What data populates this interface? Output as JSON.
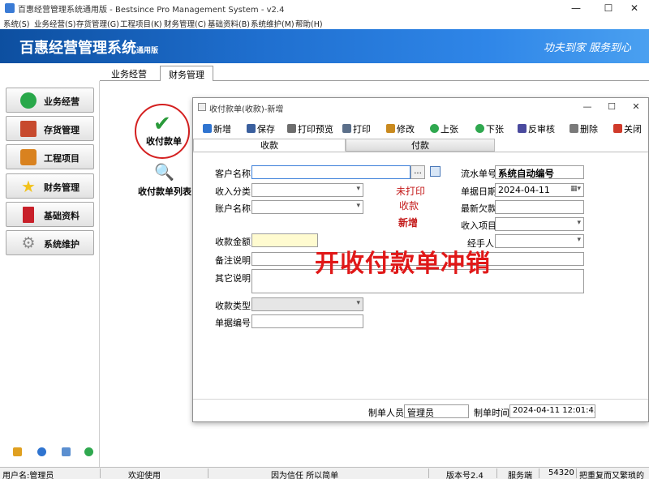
{
  "window": {
    "title": "百惠经营管理系统通用版 - Bestsince Pro Management System - v2.4",
    "controls": {
      "minimize": "—",
      "maximize": "☐",
      "close": "✕"
    }
  },
  "menu": [
    "系统(S)",
    "业务经营(S)",
    "存货管理(G)",
    "工程项目(K)",
    "财务管理(C)",
    "基础资料(B)",
    "系统维护(M)",
    "帮助(H)"
  ],
  "banner": {
    "brand": "百惠经营管理系统",
    "edition": "通用版",
    "slogan": "功夫到家 服务到心"
  },
  "sidebar": {
    "items": [
      {
        "label": "业务经营",
        "icon": "check-circle-icon",
        "color": "#29a84a"
      },
      {
        "label": "存货管理",
        "icon": "house-icon",
        "color": "#c74a2e"
      },
      {
        "label": "工程项目",
        "icon": "puzzle-icon",
        "color": "#d9821f"
      },
      {
        "label": "财务管理",
        "icon": "star-icon",
        "color": "#f2c21b"
      },
      {
        "label": "基础资料",
        "icon": "book-icon",
        "color": "#c8202a"
      },
      {
        "label": "系统维护",
        "icon": "gear-icon",
        "color": "#8a8a8a"
      }
    ]
  },
  "tabs": [
    {
      "label": "业务经营"
    },
    {
      "label": "财务管理"
    }
  ],
  "launchers": [
    {
      "label": "收付款单",
      "icon": "check-mark-icon"
    },
    {
      "label": "收付款单列表",
      "icon": "magnifier-icon"
    }
  ],
  "dialog": {
    "title": "收付款单(收款)-新增",
    "controls": {
      "minimize": "—",
      "maximize": "☐",
      "close": "✕"
    },
    "toolbar": [
      {
        "label": "新增",
        "icon": "plus-icon",
        "color": "#2f74d0"
      },
      {
        "label": "保存",
        "icon": "save-icon",
        "color": "#3a5f9e"
      },
      {
        "label": "打印预览",
        "icon": "print-preview-icon",
        "color": "#6d6d6d"
      },
      {
        "label": "打印",
        "icon": "printer-icon",
        "color": "#5b6f8a"
      },
      {
        "label": "修改",
        "icon": "edit-icon",
        "color": "#c98a1f"
      },
      {
        "label": "上张",
        "icon": "previous-icon",
        "color": "#2fa84f"
      },
      {
        "label": "下张",
        "icon": "next-icon",
        "color": "#2fa84f"
      },
      {
        "label": "反审核",
        "icon": "unapprove-icon",
        "color": "#4a4a9e"
      },
      {
        "label": "删除",
        "icon": "delete-icon",
        "color": "#7a7a7a"
      },
      {
        "label": "关闭",
        "icon": "close-door-icon",
        "color": "#d03a2a"
      }
    ],
    "subtabs": [
      "收款",
      "付款"
    ],
    "form": {
      "customer_label": "客户名称",
      "customer_value": "",
      "ellipsis": "...",
      "income_type_label": "收入分类",
      "account_label": "账户名称",
      "amount_label": "收款金额",
      "remarks_label": "备注说明",
      "other_label": "其它说明",
      "collect_type_label": "收款类型",
      "doc_no_label": "单据编号",
      "serial_label": "流水单号",
      "serial_value": "系统自动编号",
      "date_label": "单据日期",
      "date_value": "2024-04-11",
      "debt_label": "最新欠款",
      "income_item_label": "收入项目",
      "handler_label": "经手人",
      "status_print": "未打印",
      "status_kind": "收款",
      "status_mode": "新增",
      "watermark": "开收付款单冲销"
    },
    "footer": {
      "creator_label": "制单人员",
      "creator_value": "管理员",
      "time_label": "制单时间",
      "time_value": "2024-04-11 12:01:45"
    }
  },
  "statusbar": {
    "user": "用户名:管理员",
    "welcome": "欢迎使用",
    "motto": "因为信任 所以简单",
    "version": "版本号2.4",
    "server": "服务端",
    "port": "54320",
    "scroll": "把重复而又繁琐的"
  }
}
